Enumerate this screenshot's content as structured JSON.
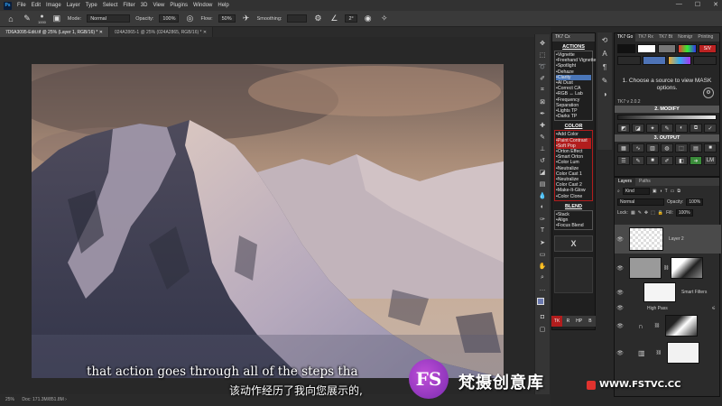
{
  "menu": [
    "File",
    "Edit",
    "Image",
    "Layer",
    "Type",
    "Select",
    "Filter",
    "3D",
    "View",
    "Plugins",
    "Window",
    "Help"
  ],
  "options_bar": {
    "brush_size": "1000",
    "mode_label": "Mode:",
    "mode_value": "Normal",
    "opacity_label": "Opacity:",
    "opacity_value": "100%",
    "flow_label": "Flow:",
    "flow_value": "50%",
    "smoothing_label": "Smoothing:",
    "angle_value": "2°"
  },
  "tabs": [
    "7D6A3095-Edit.tif @ 25% (Layer 1, RGB/16) *",
    "024A2865-1 @ 25% (024A2865, RGB/16) *"
  ],
  "status": "25%",
  "status_doc": "Doc: 171.3M/851.8M",
  "tk7": {
    "title": "TK7 Cx",
    "actions_title": "ACTIONS",
    "actions": [
      "Vignette",
      "Freehand Vignette",
      "Spotlight",
      "Dehaze",
      "Clarity",
      "AI Dust",
      "Correct CA",
      "RGB ↔ Lab",
      "Frequency Separation",
      "Lights TP",
      "Darks TP"
    ],
    "color_title": "COLOR",
    "color": [
      "Add Color",
      "Paint Contrast",
      "Soft Pop",
      "Orton Effect",
      "Smart Orton",
      "Color Lum",
      "Neutralize Color Cast 1",
      "Neutralize Color Cast 2",
      "Make-It-Glow",
      "Color Clone"
    ],
    "blend_title": "BLEND",
    "blend": [
      "Stack",
      "Align",
      "Focus Blend"
    ],
    "x_label": "X",
    "footer": [
      "TK",
      "R",
      "HP",
      "B"
    ]
  },
  "tkgo": {
    "tabs": [
      "TK7 Go",
      "TK7 Rx",
      "TK7 Bt",
      "Nomigr",
      "Printing"
    ],
    "swatch_label": "S/V",
    "message": "1. Choose a source to view MASK options.",
    "version": "TK7 v 2.0.2",
    "modify_title": "2. MODIFY",
    "output_title": "3. OUTPUT",
    "lm_label": "LM"
  },
  "layers": {
    "tabs": [
      "Layers",
      "Paths"
    ],
    "kind_label": "Kind",
    "blend_mode": "Normal",
    "opacity_label": "Opacity:",
    "opacity_value": "100%",
    "lock_label": "Lock:",
    "fill_label": "Fill:",
    "fill_value": "100%",
    "items": [
      {
        "name": "Layer 2"
      },
      {
        "name": ""
      },
      {
        "name": "Smart Filters"
      },
      {
        "name": "High Pass"
      },
      {
        "name": ""
      },
      {
        "name": ""
      }
    ]
  },
  "subtitles": {
    "en": "that action goes through all of the steps tha",
    "zh": "该动作经历了我向您展示的,"
  },
  "watermark": {
    "logo": "FS",
    "text": "梵摄创意库",
    "url": "WWW.FSTVC.CC"
  }
}
